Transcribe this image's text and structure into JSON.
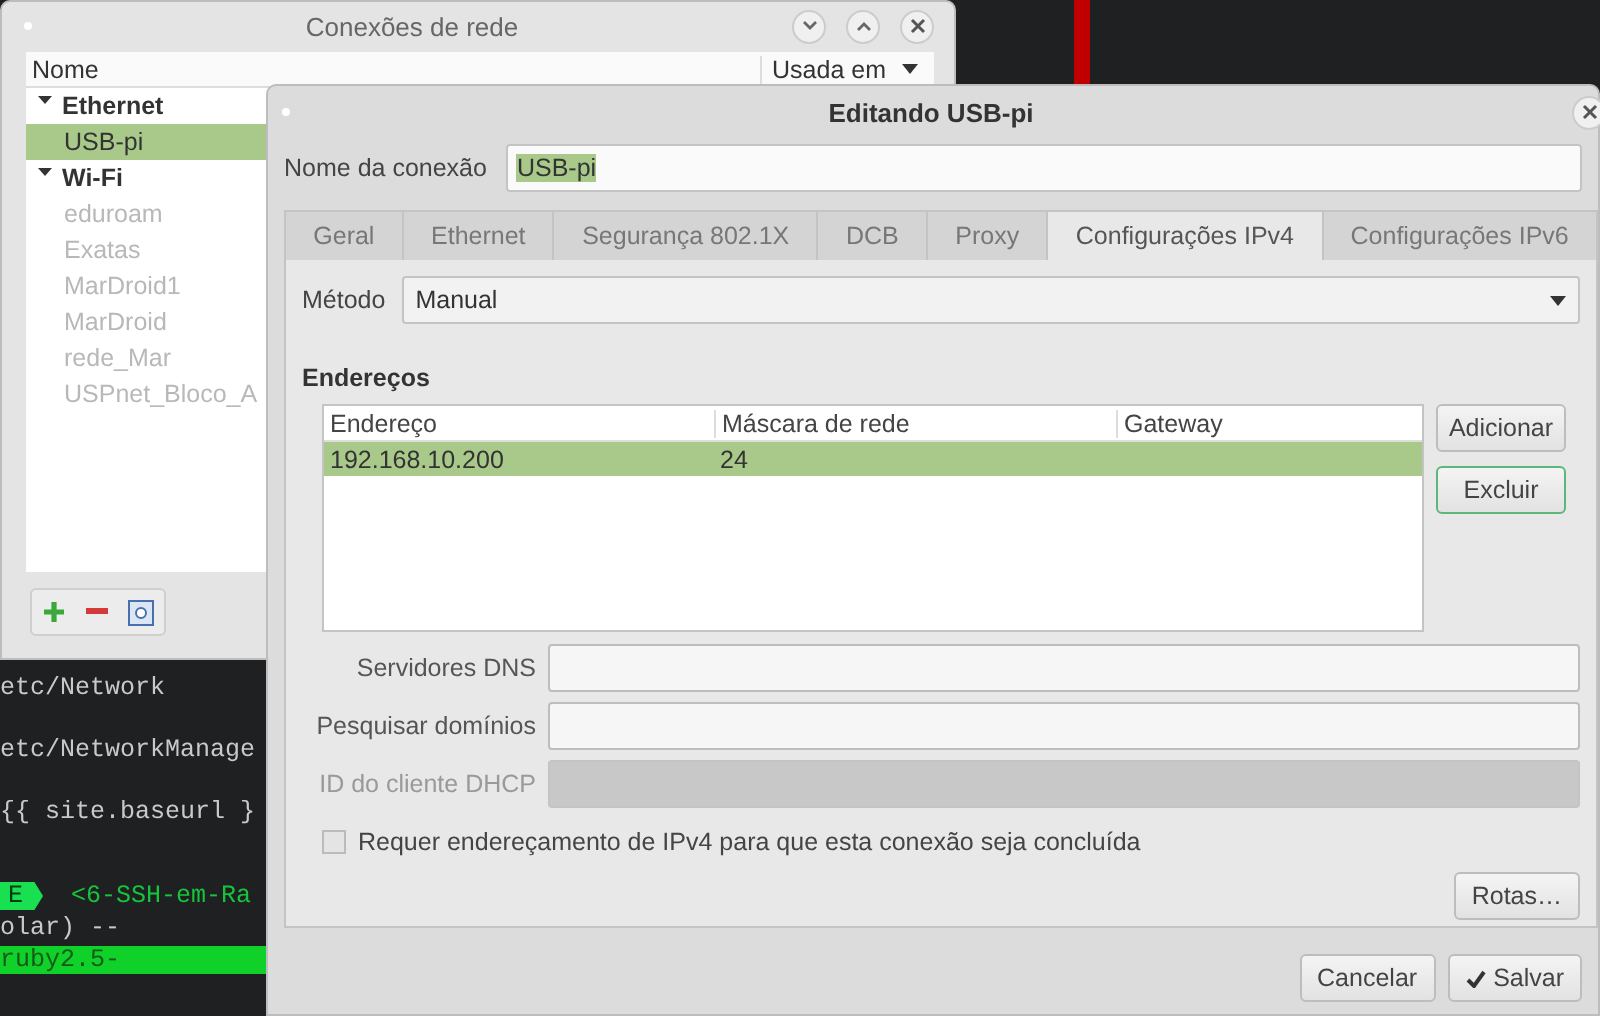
{
  "terminal": {
    "lines": [
      {
        "kind": "output",
        "text": "etc/Network"
      },
      {
        "kind": "output",
        "text": "etc/NetworkManage"
      },
      {
        "kind": "output",
        "text": "{{ site.baseurl }"
      },
      {
        "kind": "prompt",
        "badge": "E",
        "text": "<6-SSH-em-Ra"
      },
      {
        "kind": "continuation",
        "text": "olar) --"
      },
      {
        "kind": "highlight",
        "text": "ruby2.5-"
      }
    ]
  },
  "connections_window": {
    "title": "Conexões de rede",
    "columns": [
      "Nome",
      "Usada em"
    ],
    "groups": [
      {
        "name": "Ethernet",
        "expanded": true,
        "children": [
          {
            "name": "USB-pi",
            "selected": true,
            "disabled": false
          }
        ]
      },
      {
        "name": "Wi-Fi",
        "expanded": true,
        "children": [
          {
            "name": "eduroam",
            "selected": false,
            "disabled": true
          },
          {
            "name": "Exatas",
            "selected": false,
            "disabled": true
          },
          {
            "name": "MarDroid1",
            "selected": false,
            "disabled": true
          },
          {
            "name": "MarDroid",
            "selected": false,
            "disabled": true
          },
          {
            "name": "rede_Mar",
            "selected": false,
            "disabled": true
          },
          {
            "name": "USPnet_Bloco_A",
            "selected": false,
            "disabled": true
          }
        ]
      }
    ]
  },
  "editor_window": {
    "title": "Editando USB-pi",
    "connection_name": {
      "label": "Nome da conexão",
      "value": "USB-pi"
    },
    "tabs": [
      {
        "label": "Geral",
        "selected": false
      },
      {
        "label": "Ethernet",
        "selected": false
      },
      {
        "label": "Segurança 802.1X",
        "selected": false
      },
      {
        "label": "DCB",
        "selected": false
      },
      {
        "label": "Proxy",
        "selected": false
      },
      {
        "label": "Configurações IPv4",
        "selected": true
      },
      {
        "label": "Configurações IPv6",
        "selected": false
      }
    ],
    "method": {
      "label": "Método",
      "value": "Manual"
    },
    "addresses": {
      "title": "Endereços",
      "columns": [
        "Endereço",
        "Máscara de rede",
        "Gateway"
      ],
      "rows": [
        {
          "cells": [
            "192.168.10.200",
            "24"
          ],
          "selected": true
        }
      ],
      "buttons": [
        {
          "label": "Adicionar",
          "focused": false
        },
        {
          "label": "Excluir",
          "focused": true
        }
      ]
    },
    "fields": [
      {
        "label": "Servidores DNS",
        "disabled": false
      },
      {
        "label": "Pesquisar domínios",
        "disabled": false
      },
      {
        "label": "ID do cliente DHCP",
        "disabled": true
      }
    ],
    "require_ipv4": {
      "label": "Requer endereçamento de IPv4 para que esta conexão seja concluída",
      "checked": false
    },
    "routes_button": "Rotas…",
    "buttons": [
      {
        "label": "Cancelar",
        "kind": "cancel"
      },
      {
        "label": "Salvar",
        "kind": "confirm"
      }
    ]
  }
}
